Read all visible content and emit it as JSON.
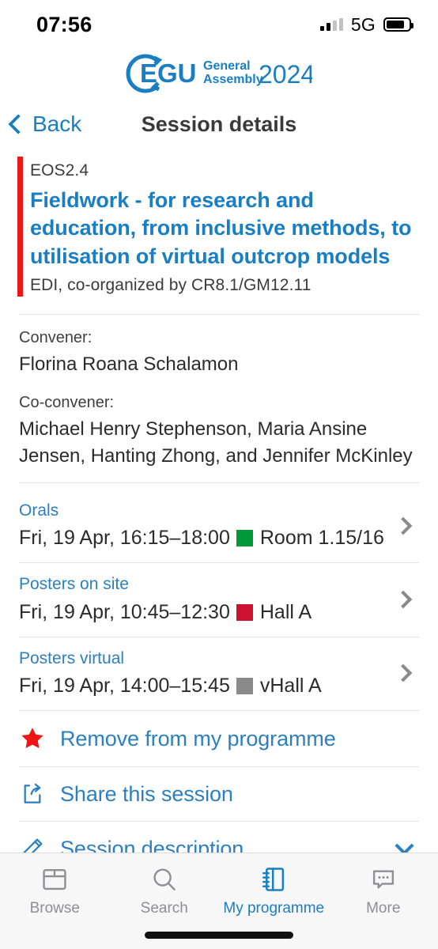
{
  "status_bar": {
    "time": "07:56",
    "network": "5G",
    "signal_icon": "signal-bars-icon",
    "battery_icon": "battery-icon"
  },
  "brand": {
    "logo_name": "egu-general-assembly-2024-logo",
    "acronym": "EGU",
    "line1": "General",
    "line2": "Assembly",
    "year": "2024",
    "color": "#1a7ec2"
  },
  "navbar": {
    "back_label": "Back",
    "back_icon": "chevron-left-icon",
    "title": "Session details"
  },
  "session": {
    "code": "EOS2.4",
    "title": "Fieldwork - for research and education, from inclusive methods, to utilisation of virtual outcrop models",
    "subtitle": "EDI, co-organized by CR8.1/GM12.11",
    "accent_color": "#ee1515",
    "convener_label": "Convener:",
    "convener_names": "Florina Roana Schalamon",
    "coconvener_label": "Co-convener:",
    "coconvener_names": "Michael Henry Stephenson, Maria Ansine Jensen, Hanting Zhong, and Jennifer McKinley"
  },
  "events": [
    {
      "kind": "Orals",
      "when": "Fri, 19 Apr, 16:15–18:00",
      "room": "Room 1.15/16",
      "swatch_color": "#00993a",
      "chevron_icon": "chevron-right-icon"
    },
    {
      "kind": "Posters on site",
      "when": "Fri, 19 Apr, 10:45–12:30",
      "room": "Hall A",
      "swatch_color": "#cc1133",
      "chevron_icon": "chevron-right-icon"
    },
    {
      "kind": "Posters virtual",
      "when": "Fri, 19 Apr, 14:00–15:45",
      "room": "vHall A",
      "swatch_color": "#8a8a8a",
      "chevron_icon": "chevron-right-icon"
    }
  ],
  "actions": {
    "remove": {
      "label": "Remove from my programme",
      "icon": "star-filled-icon",
      "icon_color": "#ee1515"
    },
    "share": {
      "label": "Share this session",
      "icon": "share-icon"
    },
    "description": {
      "label": "Session description",
      "icon": "pencil-icon",
      "expander_icon": "chevron-down-icon"
    }
  },
  "tabbar": {
    "items": [
      {
        "label": "Browse",
        "icon": "browser-window-icon",
        "active": false
      },
      {
        "label": "Search",
        "icon": "magnifier-icon",
        "active": false
      },
      {
        "label": "My programme",
        "icon": "notebook-icon",
        "active": true
      },
      {
        "label": "More",
        "icon": "speech-bubble-dots-icon",
        "active": false
      }
    ],
    "active_color": "#1a7ec2",
    "inactive_color": "#8e8e93"
  }
}
